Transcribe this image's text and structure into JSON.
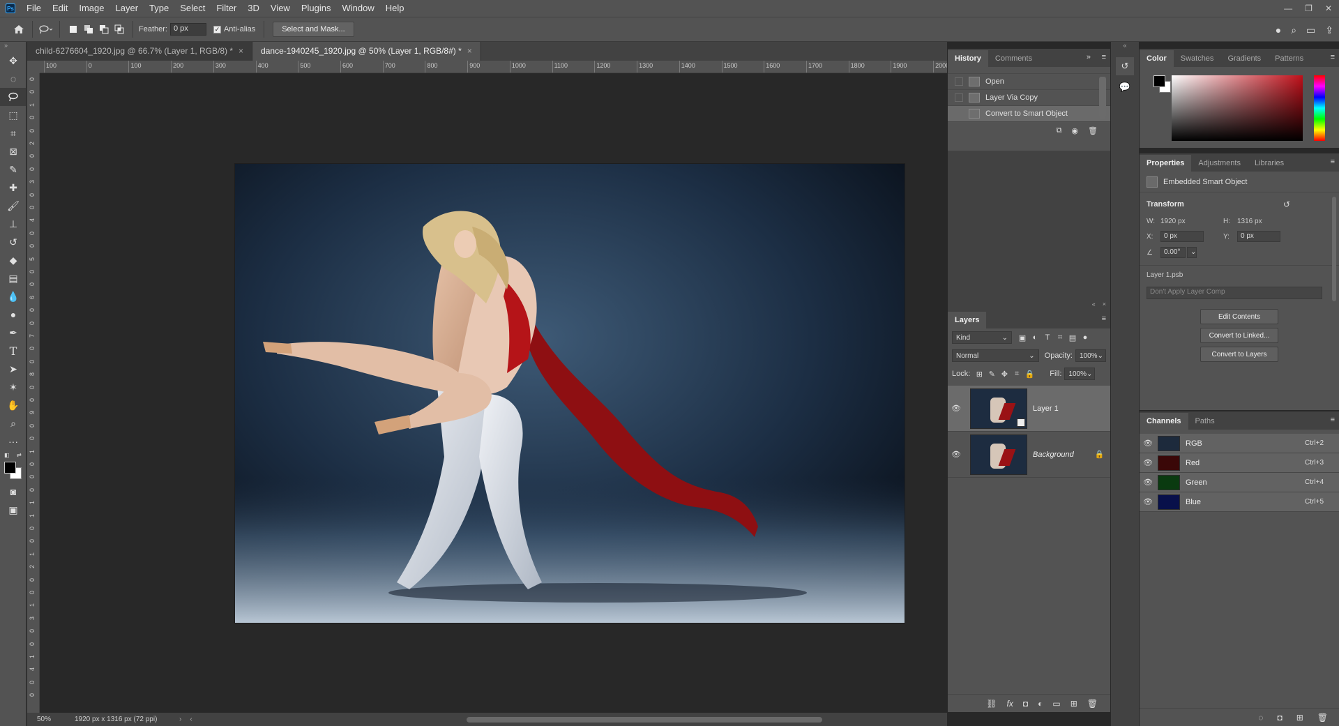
{
  "app": {
    "logo": "Ps",
    "menu": [
      "File",
      "Edit",
      "Image",
      "Layer",
      "Type",
      "Select",
      "Filter",
      "3D",
      "View",
      "Plugins",
      "Window",
      "Help"
    ],
    "window_controls": [
      "—",
      "❐",
      "✕"
    ]
  },
  "options_bar": {
    "feather_label": "Feather:",
    "feather_value": "0 px",
    "antialias_label": "Anti-alias",
    "antialias_checked": true,
    "select_mask_label": "Select and Mask..."
  },
  "tabs": [
    {
      "label": "child-6276604_1920.jpg @ 66.7% (Layer 1, RGB/8) *",
      "active": false
    },
    {
      "label": "dance-1940245_1920.jpg @ 50% (Layer 1, RGB/8#) *",
      "active": true
    }
  ],
  "ruler": {
    "h_labels": [
      "100",
      "0",
      "100",
      "200",
      "300",
      "400",
      "500",
      "600",
      "700",
      "800",
      "900",
      "1000",
      "1100",
      "1200",
      "1300",
      "1400",
      "1500",
      "1600",
      "1700",
      "1800",
      "1900",
      "2000"
    ],
    "v_labels": [
      "0",
      "0",
      "1",
      "0",
      "0",
      "2",
      "0",
      "0",
      "3",
      "0",
      "0",
      "4",
      "0",
      "0",
      "5",
      "0",
      "0",
      "6",
      "0",
      "0",
      "7",
      "0",
      "0",
      "8",
      "0",
      "0",
      "9",
      "0",
      "0",
      "1",
      "0",
      "0",
      "0",
      "1",
      "1",
      "0",
      "0",
      "1",
      "2",
      "0",
      "0",
      "1",
      "3",
      "0",
      "0",
      "1",
      "4",
      "0",
      "0"
    ]
  },
  "status": {
    "zoom": "50%",
    "doc_info": "1920 px x 1316 px (72 ppi)"
  },
  "history_panel": {
    "tabs": [
      "History",
      "Comments"
    ],
    "items": [
      {
        "label": "Open",
        "selected": false
      },
      {
        "label": "Layer Via Copy",
        "selected": false
      },
      {
        "label": "Convert to Smart Object",
        "selected": true
      }
    ]
  },
  "layers_panel": {
    "title": "Layers",
    "filter_kind": "Kind",
    "blend_mode": "Normal",
    "opacity_label": "Opacity:",
    "opacity_value": "100%",
    "lock_label": "Lock:",
    "fill_label": "Fill:",
    "fill_value": "100%",
    "layers": [
      {
        "name": "Layer 1",
        "selected": true,
        "smart": true,
        "locked": false
      },
      {
        "name": "Background",
        "selected": false,
        "smart": false,
        "locked": true
      }
    ]
  },
  "color_panel": {
    "tabs": [
      "Color",
      "Swatches",
      "Gradients",
      "Patterns"
    ],
    "fg": "#000000",
    "bg": "#ffffff",
    "hue_color": "#c0101a"
  },
  "properties_panel": {
    "tabs": [
      "Properties",
      "Adjustments",
      "Libraries"
    ],
    "type_label": "Embedded Smart Object",
    "section_transform": "Transform",
    "w_label": "W:",
    "w_value": "1920 px",
    "h_label": "H:",
    "h_value": "1316 px",
    "x_label": "X:",
    "x_value": "0 px",
    "y_label": "Y:",
    "y_value": "0 px",
    "angle_value": "0.00°",
    "linked_file": "Layer 1.psb",
    "layer_comp": "Don't Apply Layer Comp",
    "buttons": [
      "Edit Contents",
      "Convert to Linked...",
      "Convert to Layers"
    ]
  },
  "channels_panel": {
    "tabs": [
      "Channels",
      "Paths"
    ],
    "channels": [
      {
        "name": "RGB",
        "shortcut": "Ctrl+2",
        "tint": "#1d2a3c"
      },
      {
        "name": "Red",
        "shortcut": "Ctrl+3",
        "tint": "#3a0808"
      },
      {
        "name": "Green",
        "shortcut": "Ctrl+4",
        "tint": "#0a3a10"
      },
      {
        "name": "Blue",
        "shortcut": "Ctrl+5",
        "tint": "#08104a"
      }
    ]
  }
}
